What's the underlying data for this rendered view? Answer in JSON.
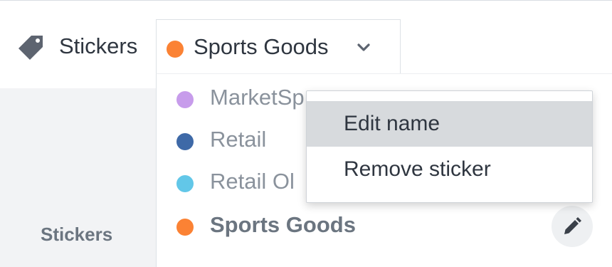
{
  "header": {
    "icon": "tag-icon",
    "label": "Stickers"
  },
  "selector": {
    "selected_label": "Sports Goods",
    "selected_color": "#fb8234",
    "chevron_icon": "chevron-down-icon"
  },
  "options": [
    {
      "label": "MarketSp",
      "color": "#c79ceb"
    },
    {
      "label": "Retail",
      "color": "#3e69a7"
    },
    {
      "label": "Retail Ol",
      "color": "#62c7e8"
    },
    {
      "label": "Sports Goods",
      "color": "#fb8234",
      "selected": true
    }
  ],
  "edit_button": {
    "icon": "pencil-icon"
  },
  "context_menu": {
    "items": [
      {
        "label": "Edit name",
        "highlighted": true
      },
      {
        "label": "Remove sticker",
        "highlighted": false
      }
    ]
  },
  "side_panel": {
    "label": "Stickers"
  }
}
